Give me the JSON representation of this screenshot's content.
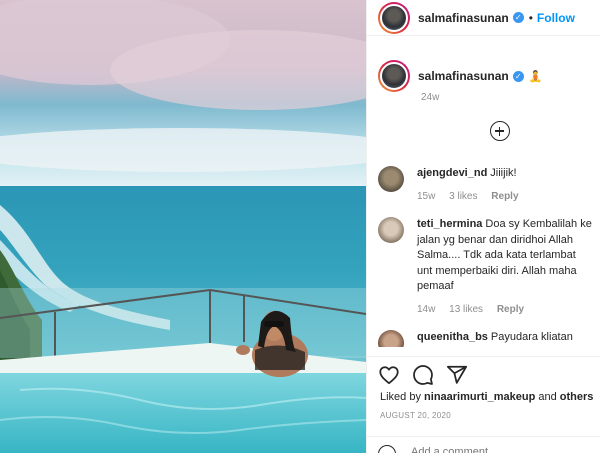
{
  "post": {
    "username": "salmafinasunan",
    "follow_label": "Follow",
    "dot": "•",
    "caption_emoji": "🧘",
    "caption_time": "24w",
    "verified_glyph": "✓"
  },
  "comments": [
    {
      "user": "ajengdevi_nd",
      "text": "Jiiijik!",
      "time": "15w",
      "likes": "3 likes",
      "reply": "Reply"
    },
    {
      "user": "teti_hermina",
      "text": "Doa sy Kembalilah ke jalan yg benar dan diridhoi Allah Salma.... Tdk ada kata terlambat unt memperbaiki diri. Allah maha pemaaf",
      "time": "14w",
      "likes": "13 likes",
      "reply": "Reply"
    },
    {
      "user": "queenitha_bs",
      "text": "Payudara kliatan",
      "time": "",
      "likes": "",
      "reply": ""
    }
  ],
  "actions": {
    "icons": [
      "heart-icon",
      "comment-icon",
      "share-icon"
    ]
  },
  "likes": {
    "prefix": "Liked by",
    "user": "ninaarimurti_makeup",
    "and": "and",
    "others": "others"
  },
  "date": "AUGUST 20, 2020",
  "add_comment": {
    "placeholder": "Add a comment..."
  }
}
